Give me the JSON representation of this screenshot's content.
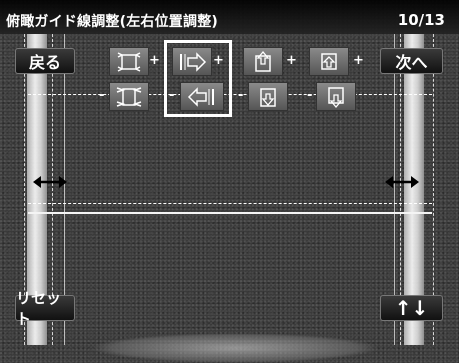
{
  "header": {
    "title": "俯瞰ガイド線調整(左右位置調整)",
    "page_indicator": "10/13"
  },
  "buttons": {
    "back": "戻る",
    "next": "次へ",
    "reset": "リセット",
    "up_down": "↑↓"
  },
  "adjust_controls": {
    "plus_sign": "+",
    "minus_sign": "-",
    "items": [
      {
        "name": "width",
        "plus_icon": "expand-width-icon",
        "minus_icon": "shrink-width-icon"
      },
      {
        "name": "left-right-position",
        "plus_icon": "move-right-icon",
        "minus_icon": "move-left-icon",
        "selected": true
      },
      {
        "name": "top",
        "plus_icon": "move-top-up-icon",
        "minus_icon": "move-top-down-icon"
      },
      {
        "name": "bottom",
        "plus_icon": "move-bottom-up-icon",
        "minus_icon": "move-bottom-down-icon"
      }
    ]
  },
  "colors": {
    "guide_line": "#ffffff",
    "header_bg": "#000000",
    "selection_border": "#ffffff"
  }
}
